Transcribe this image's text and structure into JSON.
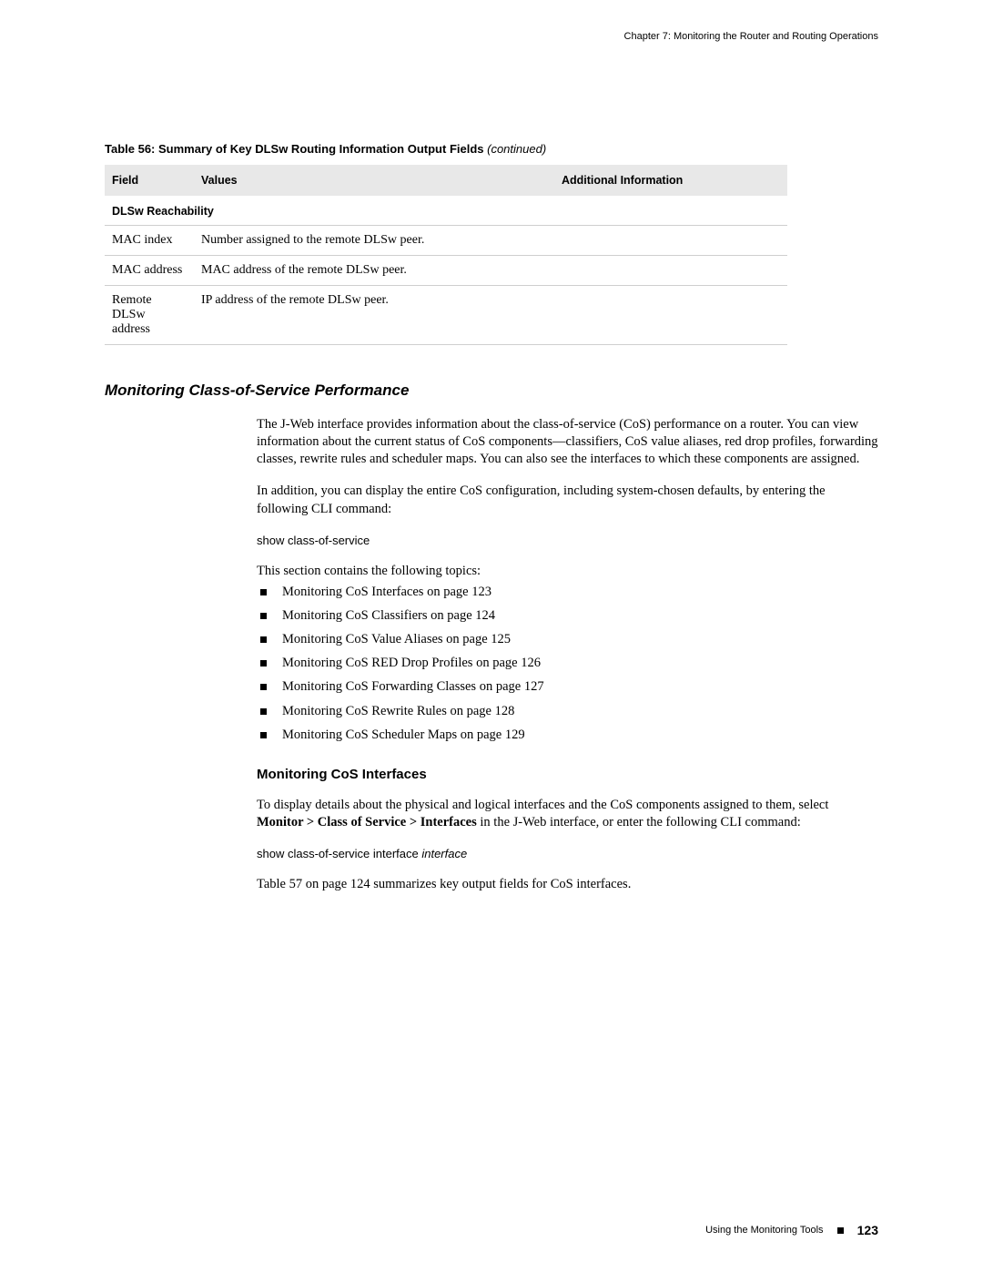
{
  "running_header": "Chapter 7: Monitoring the Router and Routing Operations",
  "table": {
    "caption_main": "Table 56: Summary of Key DLSw Routing Information Output Fields",
    "caption_suffix": " (continued)",
    "headers": {
      "c1": "Field",
      "c2": "Values",
      "c3": "Additional Information"
    },
    "section_label": "DLSw Reachability",
    "rows": [
      {
        "field": "MAC index",
        "values": "Number assigned to the remote DLSw peer."
      },
      {
        "field": "MAC address",
        "values": "MAC address of the remote DLSw peer."
      },
      {
        "field": "Remote DLSw address",
        "values": "IP address of the remote DLSw peer."
      }
    ]
  },
  "section": {
    "heading": "Monitoring Class-of-Service Performance",
    "para1": "The J-Web interface provides information about the class-of-service (CoS) performance on a router. You can view information about the current status of CoS components—classifiers, CoS value aliases, red drop profiles, forwarding classes, rewrite rules and scheduler maps. You can also see the interfaces to which these components are assigned.",
    "para2": "In addition, you can display the entire CoS configuration, including system-chosen defaults, by entering the following CLI command:",
    "command1": "show class-of-service",
    "para3": "This section contains the following topics:",
    "topics": [
      "Monitoring CoS Interfaces on page 123",
      "Monitoring CoS Classifiers on page 124",
      "Monitoring CoS Value Aliases on page 125",
      "Monitoring CoS RED Drop Profiles on page 126",
      "Monitoring CoS Forwarding Classes on page 127",
      "Monitoring CoS Rewrite Rules on page 128",
      "Monitoring CoS Scheduler Maps on page 129"
    ],
    "subheading": "Monitoring CoS Interfaces",
    "para4_pre": "To display details about the physical and logical interfaces and the CoS components assigned to them, select ",
    "para4_menu": "Monitor > Class of Service > Interfaces",
    "para4_post": " in the J-Web interface, or enter the following CLI command:",
    "command2_base": "show class-of-service interface ",
    "command2_arg": "interface",
    "para5": "Table 57 on page 124 summarizes key output fields for CoS interfaces."
  },
  "footer": {
    "label": "Using the Monitoring Tools",
    "page": "123"
  }
}
